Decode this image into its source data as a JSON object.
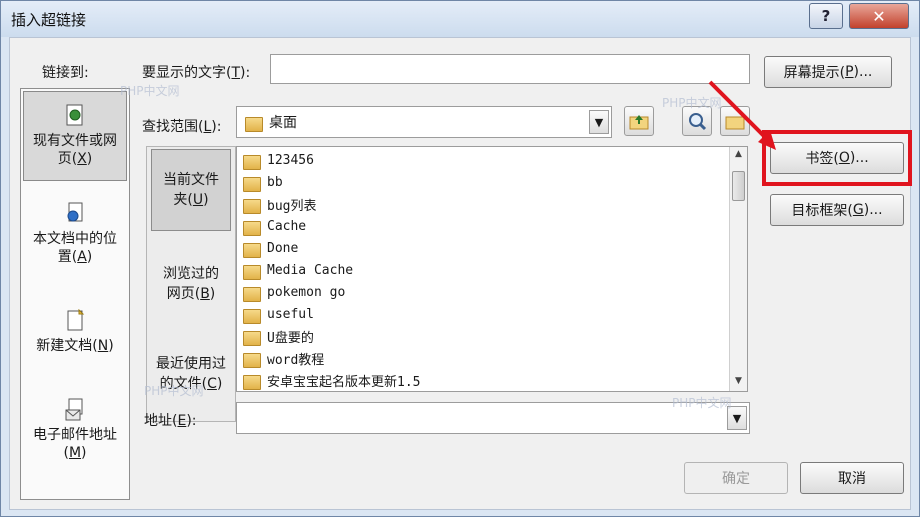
{
  "window": {
    "title": "插入超链接",
    "help_label": "?",
    "close_label": "✕"
  },
  "link_to": {
    "label": "链接到:",
    "items": [
      {
        "label_main": "现有文件或网",
        "label_tail": "页(",
        "key": "X",
        "end": ")",
        "icon": "document-globe-icon",
        "selected": true
      },
      {
        "label_main": "本文档中的位",
        "label_tail": "置(",
        "key": "A",
        "end": ")",
        "icon": "document-bookmark-icon",
        "selected": false
      },
      {
        "label_main": "",
        "label_tail": "新建文档(",
        "key": "N",
        "end": ")",
        "icon": "new-document-icon",
        "selected": false
      },
      {
        "label_main": "电子邮件地址",
        "label_tail": "(",
        "key": "M",
        "end": ")",
        "icon": "email-icon",
        "selected": false
      }
    ]
  },
  "display_text": {
    "label": "要显示的文字(",
    "key": "T",
    "end": "):",
    "value": ""
  },
  "screentip_button": {
    "label": "屏幕提示(",
    "key": "P",
    "end": ")..."
  },
  "look_in": {
    "label": "查找范围(",
    "key": "L",
    "end": "):",
    "value": "桌面",
    "icon": "folder-icon"
  },
  "toolbar_icons": [
    "folder-up-icon",
    "browse-web-icon",
    "browse-file-icon"
  ],
  "places": [
    {
      "line1": "当前文件",
      "line2": "夹(",
      "key": "U",
      "end": ")",
      "selected": true
    },
    {
      "line1": "浏览过的",
      "line2": "网页(",
      "key": "B",
      "end": ")",
      "selected": false
    },
    {
      "line1": "最近使用过",
      "line2": "的文件(",
      "key": "C",
      "end": ")",
      "selected": false
    }
  ],
  "files": [
    "123456",
    "bb",
    "bug列表",
    "Cache",
    "Done",
    "Media Cache",
    "pokemon go",
    "useful",
    "U盘要的",
    "word教程",
    "安卓宝宝起名版本更新1.5"
  ],
  "bookmark_button": {
    "label": "书签(",
    "key": "O",
    "end": ")..."
  },
  "target_frame_button": {
    "label": "目标框架(",
    "key": "G",
    "end": ")..."
  },
  "address": {
    "label": "地址(",
    "key": "E",
    "end": "):",
    "value": ""
  },
  "ok_button": {
    "label": "确定"
  },
  "cancel_button": {
    "label": "取消"
  },
  "watermarks": [
    "PHP中文网",
    "PHP中文网",
    "PHP中文网",
    "PHP中文网"
  ],
  "colors": {
    "highlight": "#e0141e",
    "window_frame": "#dbe6f3"
  }
}
